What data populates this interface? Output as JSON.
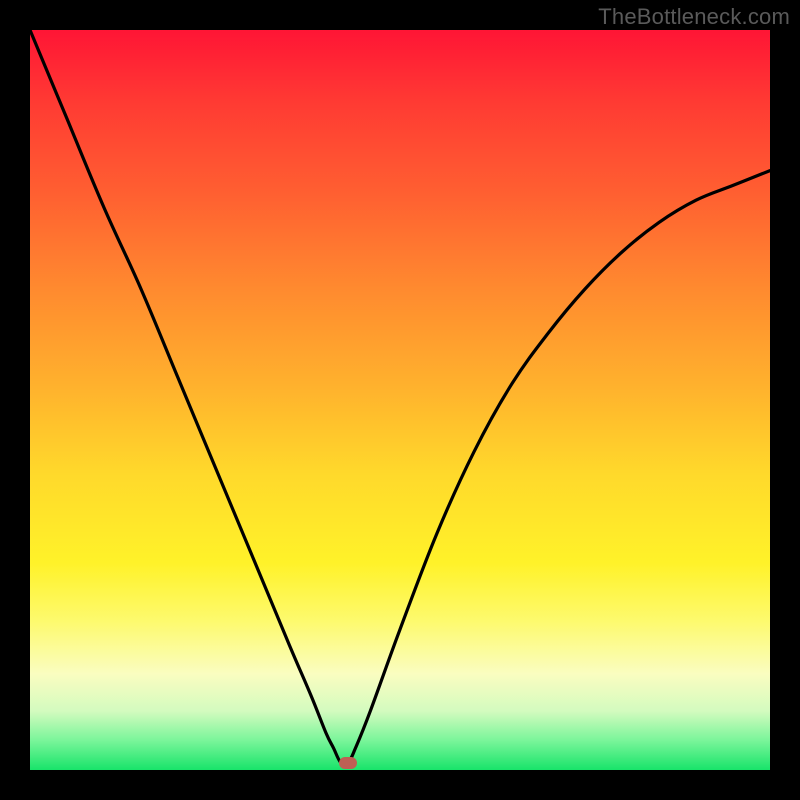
{
  "watermark": "TheBottleneck.com",
  "colors": {
    "frame": "#000000",
    "curve": "#000000",
    "marker": "#be5f54",
    "gradient_top": "#ff1535",
    "gradient_bottom": "#18e46a"
  },
  "chart_data": {
    "type": "line",
    "title": "",
    "xlabel": "",
    "ylabel": "",
    "xlim": [
      0,
      100
    ],
    "ylim": [
      0,
      100
    ],
    "grid": false,
    "legend": false,
    "notch_x": 42,
    "marker": {
      "x": 43,
      "y": 1
    },
    "series": [
      {
        "name": "curve",
        "x": [
          0,
          5,
          10,
          15,
          20,
          25,
          30,
          35,
          38,
          40,
          41,
          42,
          43,
          44,
          46,
          50,
          55,
          60,
          65,
          70,
          75,
          80,
          85,
          90,
          95,
          100
        ],
        "y": [
          100,
          88,
          76,
          65,
          53,
          41,
          29,
          17,
          10,
          5,
          3,
          1,
          1,
          3,
          8,
          19,
          32,
          43,
          52,
          59,
          65,
          70,
          74,
          77,
          79,
          81
        ]
      }
    ]
  }
}
